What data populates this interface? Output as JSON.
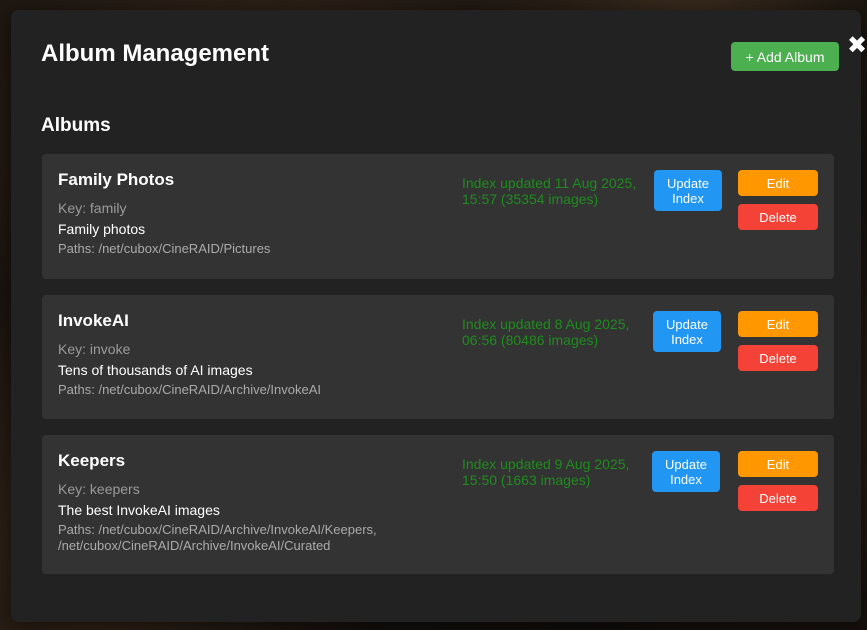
{
  "modal": {
    "title": "Album Management",
    "close_icon": "✖",
    "add_button_label": "+ Add Album",
    "section_title": "Albums"
  },
  "albums": [
    {
      "name": "Family Photos",
      "key": "Key: family",
      "description": "Family photos",
      "paths": "Paths: /net/cubox/CineRAID/Pictures",
      "status": "Index updated 11 Aug 2025, 15:57 (35354 images)",
      "update_label": "Update Index",
      "edit_label": "Edit",
      "delete_label": "Delete"
    },
    {
      "name": "InvokeAI",
      "key": "Key: invoke",
      "description": "Tens of thousands of AI images",
      "paths": "Paths: /net/cubox/CineRAID/Archive/InvokeAI",
      "status": "Index updated 8 Aug 2025, 06:56 (80486 images)",
      "update_label": "Update Index",
      "edit_label": "Edit",
      "delete_label": "Delete"
    },
    {
      "name": "Keepers",
      "key": "Key: keepers",
      "description": "The best InvokeAI images",
      "paths": "Paths: /net/cubox/CineRAID/Archive/InvokeAI/Keepers, /net/cubox/CineRAID/Archive/InvokeAI/Curated",
      "status": "Index updated 9 Aug 2025, 15:50 (1663 images)",
      "update_label": "Update Index",
      "edit_label": "Edit",
      "delete_label": "Delete"
    }
  ],
  "colors": {
    "modal_bg": "#222222",
    "card_bg": "#333333",
    "add_button": "#4caf50",
    "update_button": "#2196f3",
    "edit_button": "#ff9800",
    "delete_button": "#f44336",
    "status_text": "#1e8c1e"
  }
}
